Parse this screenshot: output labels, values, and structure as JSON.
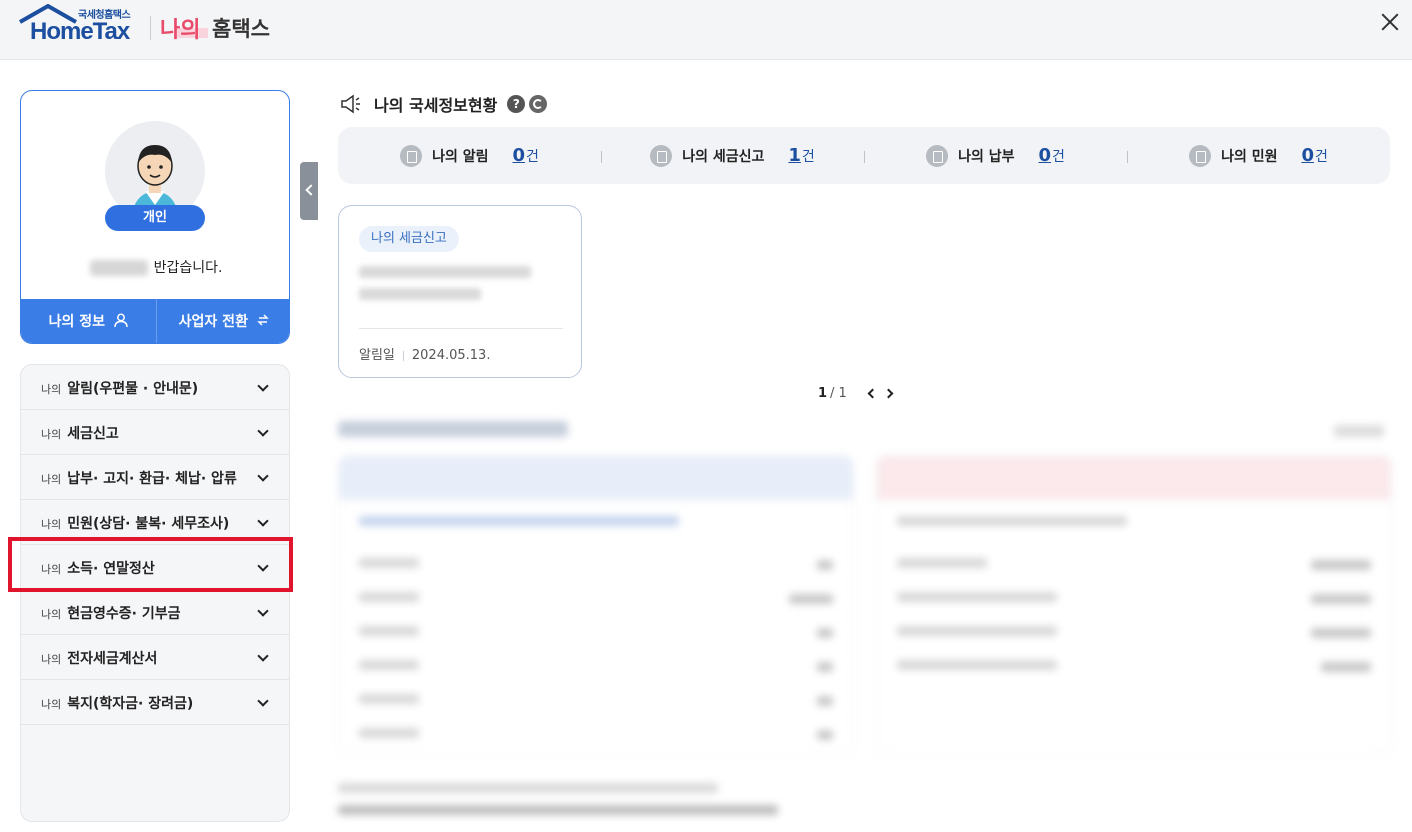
{
  "header": {
    "logo_top": "국세청홈택스",
    "logo_main": "HomeTax",
    "brand_my": "나의",
    "brand_hometax": "홈택스"
  },
  "profile": {
    "badge": "개인",
    "greeting": "반갑습니다.",
    "my_info_label": "나의 정보",
    "switch_label": "사업자 전환"
  },
  "menu": {
    "prefix": "나의",
    "items": [
      "알림(우편물 · 안내문)",
      "세금신고",
      "납부· 고지· 환급· 체납· 압류",
      "민원(상담· 불복· 세무조사)",
      "소득· 연말정산",
      "현금영수증· 기부금",
      "전자세금계산서",
      "복지(학자금· 장려금)"
    ]
  },
  "section": {
    "title": "나의 국세정보현황",
    "help": "?"
  },
  "summary": [
    {
      "label": "나의 알림",
      "count": "0",
      "unit": "건"
    },
    {
      "label": "나의 세금신고",
      "count": "1",
      "unit": "건"
    },
    {
      "label": "나의 납부",
      "count": "0",
      "unit": "건"
    },
    {
      "label": "나의 민원",
      "count": "0",
      "unit": "건"
    }
  ],
  "notice_card": {
    "tag": "나의 세금신고",
    "date_label": "알림일",
    "date": "2024.05.13."
  },
  "pager": {
    "current": "1",
    "total": "/ 1"
  }
}
